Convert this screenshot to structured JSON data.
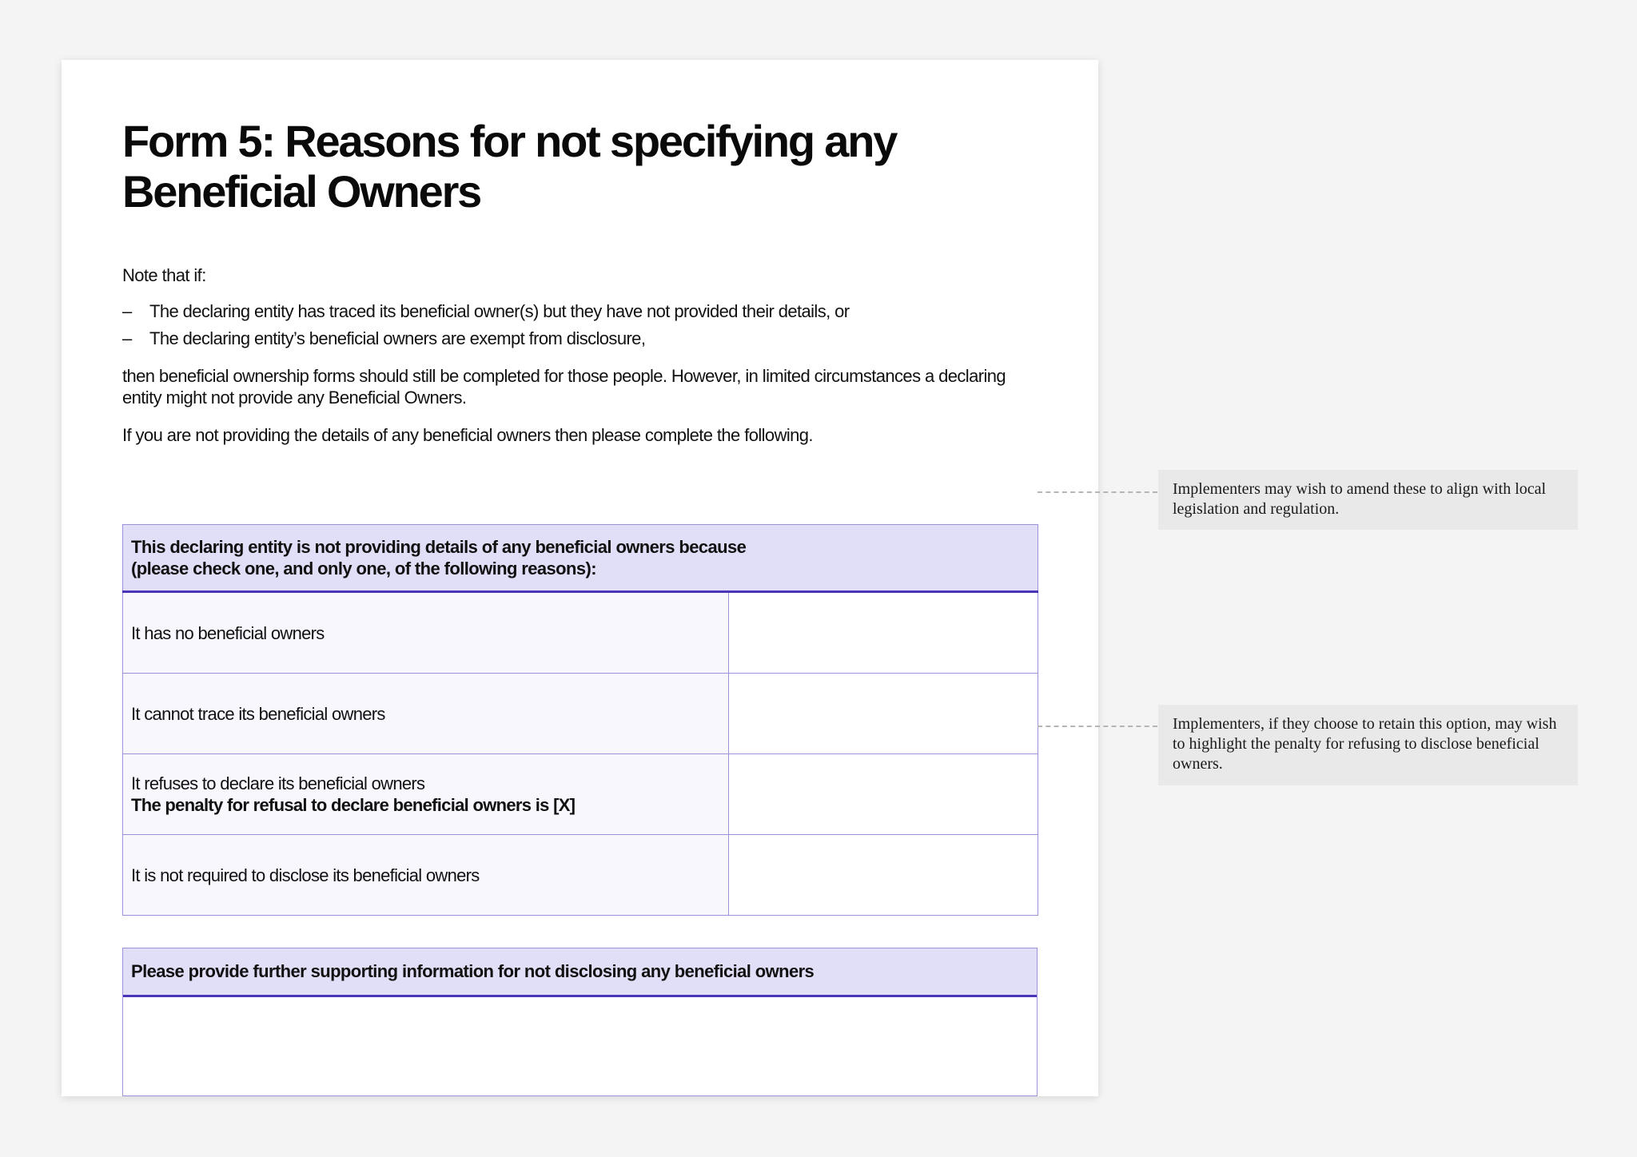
{
  "title": {
    "line1": "Form 5: Reasons for not specifying any",
    "line2": "Beneficial Owners"
  },
  "intro": {
    "note_that": "Note that if:",
    "bullets": [
      {
        "dash": "–",
        "text": "The declaring entity has traced its beneficial owner(s) but they have not provided their details, or"
      },
      {
        "dash": "–",
        "text": "The declaring entity’s beneficial owners are exempt from disclosure,"
      }
    ],
    "then_text": "then beneficial ownership forms should still be completed for those people. However, in limited circumstances a declaring entity might not provide any Beneficial Owners.",
    "instruction": "If you are not providing the details of any beneficial owners then please complete the following."
  },
  "reasons_table": {
    "header_line1": "This declaring entity is not providing details of any beneficial owners because",
    "header_line2": "(please check one, and only one, of the following reasons):",
    "rows": [
      {
        "label": "It has no beneficial owners",
        "extra": ""
      },
      {
        "label": "It cannot trace its beneficial owners",
        "extra": ""
      },
      {
        "label": "It refuses to declare its beneficial owners",
        "extra": "The penalty for refusal to declare beneficial owners is [X]"
      },
      {
        "label": "It is not required to disclose its beneficial owners",
        "extra": ""
      }
    ]
  },
  "support_table": {
    "header": "Please provide further supporting information for not disclosing any beneficial owners"
  },
  "notes": [
    {
      "text": "Implementers may wish to amend these to align with local legislation and regulation."
    },
    {
      "text": "Implementers, if they choose to retain this option, may wish to highlight the penalty for refusing to disclose beneficial owners."
    }
  ]
}
